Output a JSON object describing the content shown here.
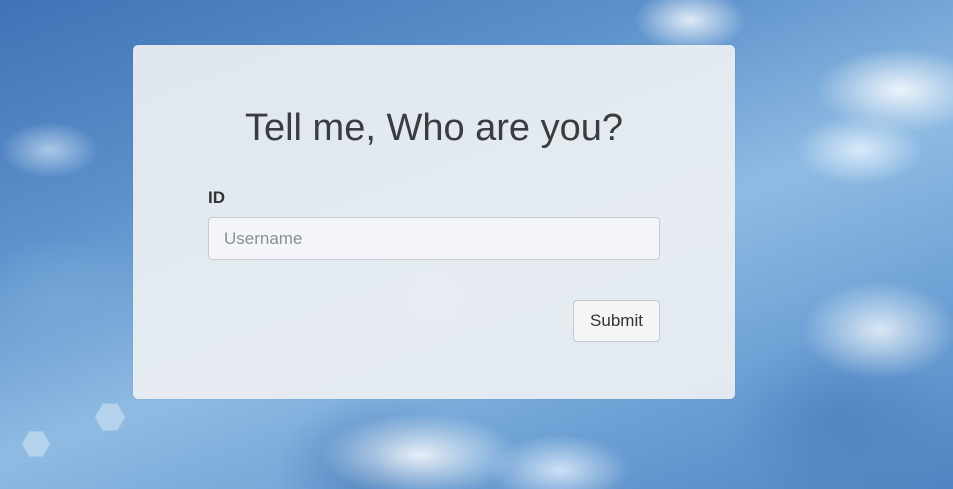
{
  "form": {
    "heading": "Tell me, Who are you?",
    "id_label": "ID",
    "username_placeholder": "Username",
    "username_value": "",
    "submit_label": "Submit"
  },
  "colors": {
    "card_background": "#eceff2",
    "heading_text": "#3a3d40",
    "sky_blue": "#5d92cc"
  }
}
